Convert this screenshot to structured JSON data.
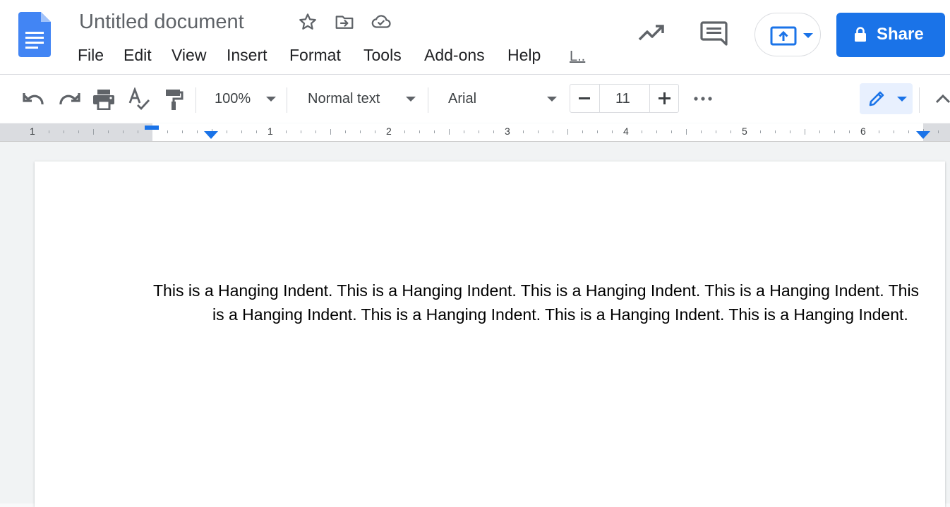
{
  "header": {
    "title": "Untitled document",
    "menu": [
      "File",
      "Edit",
      "View",
      "Insert",
      "Format",
      "Tools",
      "Add-ons",
      "Help"
    ],
    "last_edit_label": "L..",
    "share_label": "Share"
  },
  "toolbar": {
    "zoom": "100%",
    "style": "Normal text",
    "font": "Arial",
    "font_size": "11"
  },
  "ruler": {
    "labels": [
      "1",
      "1",
      "2",
      "3",
      "4",
      "5",
      "6"
    ]
  },
  "document": {
    "paragraph": "This is a Hanging Indent. This is a Hanging Indent. This is a Hanging Indent. This is a Hanging Indent. This is a Hanging Indent. This is a Hanging Indent. This is a Hanging Indent. This is a Hanging Indent."
  },
  "colors": {
    "accent": "#1a73e8",
    "icon_gray": "#5f6368"
  }
}
